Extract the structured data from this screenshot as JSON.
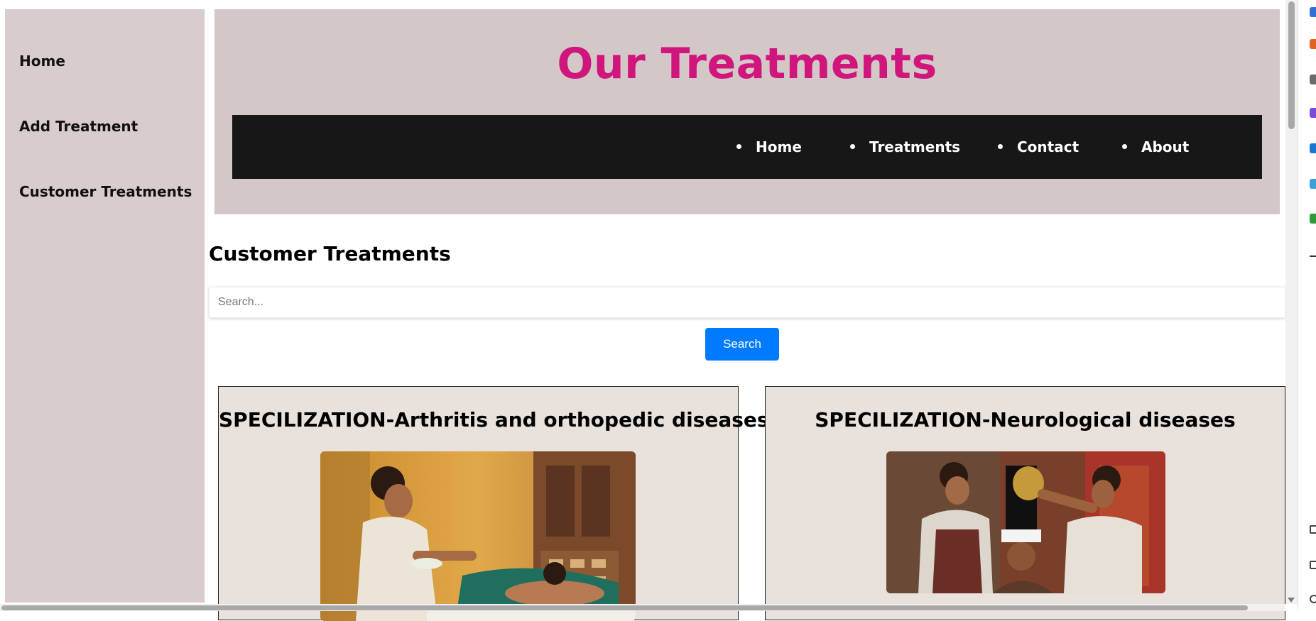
{
  "sidebar": {
    "items": [
      {
        "label": "Home"
      },
      {
        "label": "Add Treatment"
      },
      {
        "label": "Customer Treatments"
      }
    ],
    "background": "#d9cccc"
  },
  "header": {
    "title": "Our Treatments",
    "title_color": "#d0157c",
    "background": "#d3c7c7",
    "nav": {
      "background": "#171717",
      "items": [
        {
          "label": "Home"
        },
        {
          "label": "Treatments"
        },
        {
          "label": "Contact"
        },
        {
          "label": "About"
        }
      ]
    }
  },
  "main": {
    "heading": "Customer Treatments",
    "search": {
      "placeholder": "Search...",
      "value": "",
      "button_label": "Search",
      "button_color": "#007bff"
    },
    "cards": [
      {
        "title": "SPECILIZATION-Arthritis and orthopedic diseases",
        "image": "therapist-massage-photo"
      },
      {
        "title": "SPECILIZATION-Neurological diseases",
        "image": "head-oil-therapy-photo"
      }
    ]
  },
  "browser": {
    "side_icons": [
      "extension-icon-blue",
      "extension-icon-orange",
      "extension-icon-gray",
      "extension-icon-purple",
      "extension-icon-outlook",
      "extension-icon-funnel",
      "extension-icon-green",
      "extension-icon-plus",
      "extension-icon-window",
      "extension-icon-copy",
      "extension-icon-settings"
    ]
  }
}
